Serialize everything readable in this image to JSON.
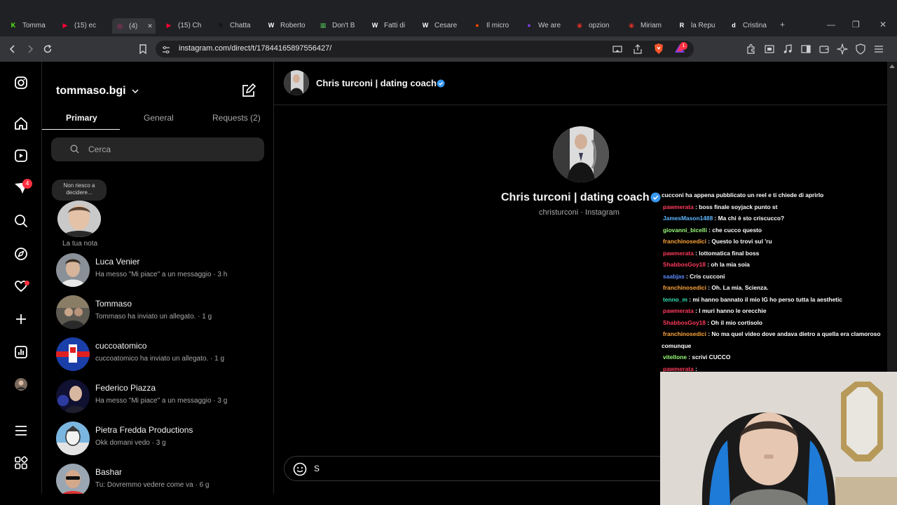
{
  "browser": {
    "tabs": [
      {
        "label": "Tomma",
        "fav": "K",
        "color": "#53fc18"
      },
      {
        "label": "(15) ec",
        "fav": "▶",
        "color": "#ff0033"
      },
      {
        "label": "(4)",
        "fav": "◎",
        "color": "#d62976",
        "active": true
      },
      {
        "label": "(15) Ch",
        "fav": "▶",
        "color": "#ff0033"
      },
      {
        "label": "Chatta",
        "fav": "✻",
        "color": "#111111"
      },
      {
        "label": "Roberto",
        "fav": "W",
        "color": "#ffffff"
      },
      {
        "label": "Don't B",
        "fav": "▦",
        "color": "#4caf50"
      },
      {
        "label": "Fatti di",
        "fav": "W",
        "color": "#ffffff"
      },
      {
        "label": "Cesare",
        "fav": "W",
        "color": "#ffffff"
      },
      {
        "label": "Il micro",
        "fav": "●",
        "color": "#ff4500"
      },
      {
        "label": "We are",
        "fav": "●",
        "color": "#7b3fe4"
      },
      {
        "label": "opzion",
        "fav": "◉",
        "color": "#d93025"
      },
      {
        "label": "Miriam",
        "fav": "◉",
        "color": "#d93025"
      },
      {
        "label": "la Repu",
        "fav": "R",
        "color": "#ffffff"
      },
      {
        "label": "Cristina",
        "fav": "d",
        "color": "#ffffff"
      }
    ],
    "new_tab": "+",
    "url": "instagram.com/direct/t/17844165897556427/",
    "extension_badge": "1"
  },
  "inbox": {
    "username": "tommaso.bgi",
    "tabs": {
      "primary": "Primary",
      "general": "General",
      "requests": "Requests (2)"
    },
    "search_placeholder": "Cerca",
    "note_bubble": "Non riesco a decidere...",
    "note_label": "La tua nota",
    "notif_badge": "4",
    "conversations": [
      {
        "name": "Luca Venier",
        "preview": "Ha messo \"Mi piace\" a un messaggio · 3 h"
      },
      {
        "name": "Tommaso",
        "preview": "Tommaso ha inviato un allegato. · 1 g"
      },
      {
        "name": "cuccoatomico",
        "preview": "cuccoatomico ha inviato un allegato. · 1 g"
      },
      {
        "name": "Federico Piazza",
        "preview": "Ha messo \"Mi piace\" a un messaggio · 3 g"
      },
      {
        "name": "Pietra Fredda Productions",
        "preview": "Okk domani vedo · 3 g"
      },
      {
        "name": "Bashar",
        "preview": "Tu: Dovremmo vedere come va · 6 g"
      }
    ]
  },
  "chat": {
    "header_name": "Chris turconi | dating coach",
    "profile_name": "Chris turconi | dating coach",
    "profile_sub": "christurconi · Instagram",
    "composer_text": "S"
  },
  "stream_chat": [
    {
      "user": "",
      "text": "cucconi ha appena pubblicato un reel e ti chiede di aprirlo",
      "color": "#ffffff"
    },
    {
      "user": "pawmerata",
      "text": " : boss finale soyjack punto st",
      "color": "#ff3b5c"
    },
    {
      "user": "JamesMason1488",
      "text": " : Ma chi è sto criscucco?",
      "color": "#5fb7ff"
    },
    {
      "user": "giovanni_bicelli",
      "text": " : che cucco questo",
      "color": "#9bff7a"
    },
    {
      "user": "franchinosedici",
      "text": " : Questo lo trovi sul 'ru",
      "color": "#ffa53a"
    },
    {
      "user": "pawmerata",
      "text": " : lottomatica final boss",
      "color": "#ff3b5c"
    },
    {
      "user": "ShabbosGoy18",
      "text": " : oh la mia soia",
      "color": "#ff3b5c"
    },
    {
      "user": "saabjas",
      "text": " : Cris cucconi",
      "color": "#5f8cff"
    },
    {
      "user": "franchinosedici",
      "text": " : Oh. La mia. Scienza.",
      "color": "#ffa53a"
    },
    {
      "user": "tenno_m",
      "text": " : mi hanno bannato il mio IG ho perso tutta la aesthetic",
      "color": "#34e0b0"
    },
    {
      "user": "pawmerata",
      "text": " : I muri hanno le orecchie",
      "color": "#ff3b5c"
    },
    {
      "user": "ShabbosGoy18",
      "text": " : Oh il mio cortisolo",
      "color": "#ff3b5c"
    },
    {
      "user": "franchinosedici",
      "text": " : No ma quel video dove andava dietro a quella era clamoroso",
      "color": "#ffa53a"
    },
    {
      "user": "",
      "text": "comunque",
      "color": "#ffffff"
    },
    {
      "user": "vitellone",
      "text": " : scrivi CUCCO",
      "color": "#9bff7a"
    },
    {
      "user": "pawmerata",
      "text": " : ",
      "color": "#ff3b5c"
    }
  ],
  "colors": {
    "verified": "#3897f0",
    "badge": "#ff3040",
    "brave": "#fb542b"
  }
}
